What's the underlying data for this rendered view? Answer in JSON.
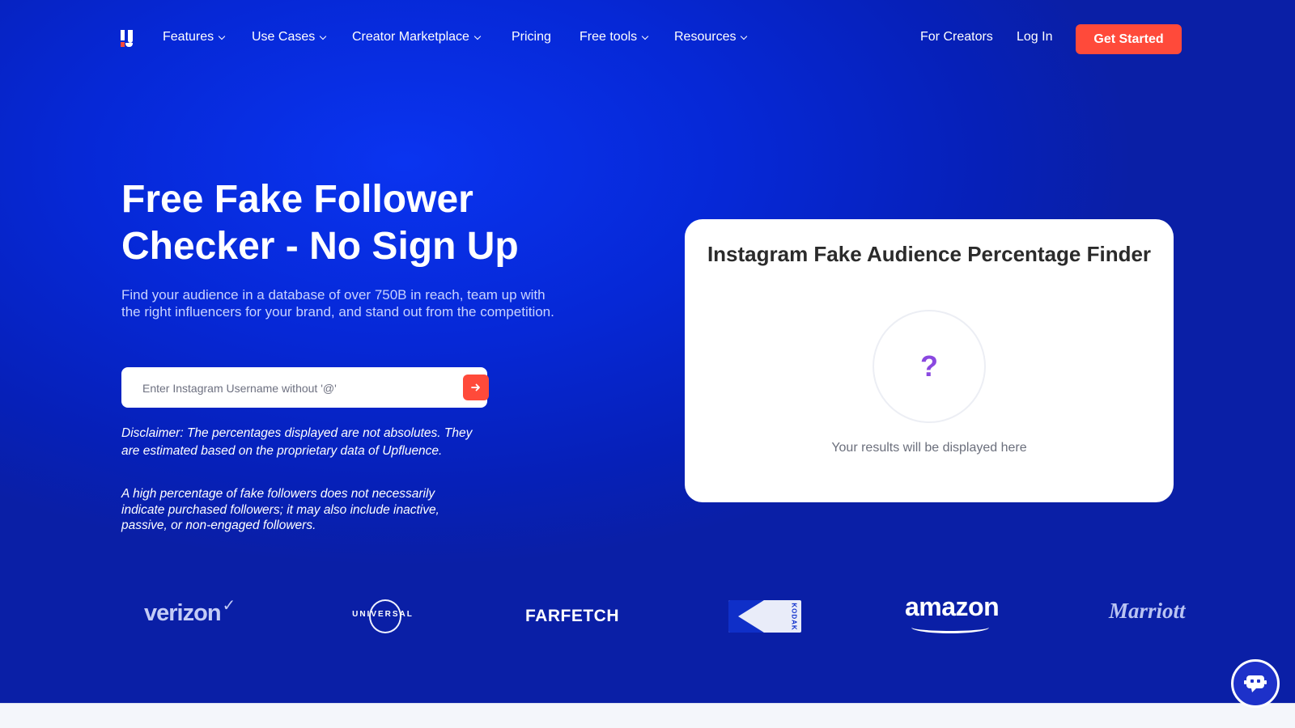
{
  "nav": {
    "logo_alt": "Upfluence",
    "items": [
      {
        "label": "Features",
        "dropdown": true
      },
      {
        "label": "Use Cases",
        "dropdown": true
      },
      {
        "label": "Creator Marketplace",
        "dropdown": true
      },
      {
        "label": "Pricing",
        "dropdown": false
      },
      {
        "label": "Free tools",
        "dropdown": true
      },
      {
        "label": "Resources",
        "dropdown": true
      }
    ],
    "for_creators": "For Creators",
    "login": "Log In",
    "get_started": "Get Started"
  },
  "hero": {
    "title": "Free Fake Follower Checker - No Sign Up",
    "subtitle": "Find your audience in a database of over 750B in reach, team up with the right influencers for your brand, and stand out from the competition.",
    "search_placeholder": "Enter Instagram Username without '@'",
    "search_value": "",
    "submit_icon": "arrow-right-icon",
    "disclaimer_1": "Disclaimer: The percentages displayed are not absolutes. They are estimated based on the proprietary data of Upfluence.",
    "disclaimer_2": "A high percentage of fake followers does not necessarily indicate purchased followers; it may also include inactive, passive, or non-engaged followers."
  },
  "card": {
    "title": "Instagram Fake Audience Percentage Finder",
    "placeholder_symbol": "?",
    "result_text": "Your results will be displayed here"
  },
  "brands": {
    "verizon": "verizon",
    "universal": "UNIVERSAL",
    "farfetch": "FARFETCH",
    "kodak": "KODAK",
    "amazon": "amazon",
    "marriott": "Marriott"
  },
  "colors": {
    "background": "#0628d6",
    "accent": "#ff4a3a",
    "card": "#ffffff",
    "question_mark": "#8a48e0"
  },
  "chat": {
    "icon": "chatbot-icon"
  }
}
